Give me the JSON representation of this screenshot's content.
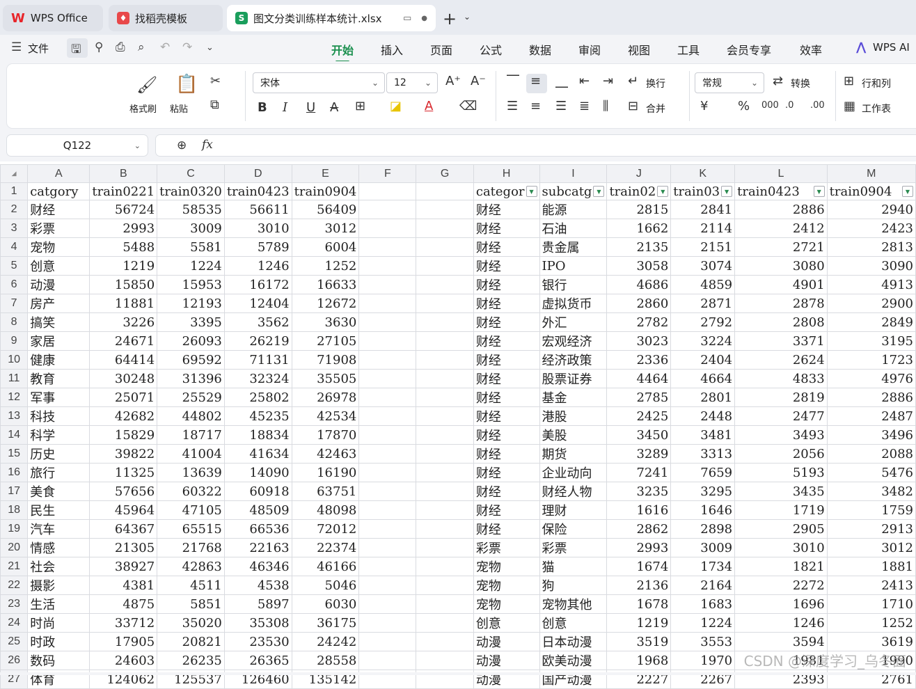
{
  "tabs": [
    {
      "label": "WPS Office",
      "icon": "wps-logo-icon"
    },
    {
      "label": "找稻壳模板",
      "icon": "docer-icon"
    },
    {
      "label": "图文分类训练样本统计.xlsx",
      "icon": "spreadsheet-icon",
      "active": true
    }
  ],
  "menu": {
    "file_label": "文件",
    "tabs": [
      "开始",
      "插入",
      "页面",
      "公式",
      "数据",
      "审阅",
      "视图",
      "工具",
      "会员专享",
      "效率"
    ],
    "active_tab": "开始",
    "ai_label": "WPS AI"
  },
  "ribbon": {
    "format_painter": "格式刷",
    "paste": "粘贴",
    "font_name": "宋体",
    "font_size": "12",
    "wrap": "换行",
    "merge": "合并",
    "number_format": "常规",
    "convert": "转换",
    "row_col": "行和列",
    "worksheet": "工作表"
  },
  "formula_bar": {
    "name_box": "Q122",
    "fx": "fx",
    "content": ""
  },
  "sheet": {
    "columns": [
      "A",
      "B",
      "C",
      "D",
      "E",
      "F",
      "G",
      "H",
      "I",
      "J",
      "K",
      "L",
      "M"
    ],
    "header_row": [
      "catgory",
      "train0221",
      "train0320",
      "train0423",
      "train0904",
      "",
      "",
      "categor",
      "subcatg",
      "train02",
      "train03",
      "train0423",
      "train0904"
    ],
    "rows": [
      [
        "财经",
        "56724",
        "58535",
        "56611",
        "56409",
        "",
        "",
        "财经",
        "能源",
        "2815",
        "2841",
        "2886",
        "2940"
      ],
      [
        "彩票",
        "2993",
        "3009",
        "3010",
        "3012",
        "",
        "",
        "财经",
        "石油",
        "1662",
        "2114",
        "2412",
        "2423"
      ],
      [
        "宠物",
        "5488",
        "5581",
        "5789",
        "6004",
        "",
        "",
        "财经",
        "贵金属",
        "2135",
        "2151",
        "2721",
        "2813"
      ],
      [
        "创意",
        "1219",
        "1224",
        "1246",
        "1252",
        "",
        "",
        "财经",
        "IPO",
        "3058",
        "3074",
        "3080",
        "3090"
      ],
      [
        "动漫",
        "15850",
        "15953",
        "16172",
        "16633",
        "",
        "",
        "财经",
        "银行",
        "4686",
        "4859",
        "4901",
        "4913"
      ],
      [
        "房产",
        "11881",
        "12193",
        "12404",
        "12672",
        "",
        "",
        "财经",
        "虚拟货币",
        "2860",
        "2871",
        "2878",
        "2900"
      ],
      [
        "搞笑",
        "3226",
        "3395",
        "3562",
        "3630",
        "",
        "",
        "财经",
        "外汇",
        "2782",
        "2792",
        "2808",
        "2849"
      ],
      [
        "家居",
        "24671",
        "26093",
        "26219",
        "27105",
        "",
        "",
        "财经",
        "宏观经济",
        "3023",
        "3224",
        "3371",
        "3195"
      ],
      [
        "健康",
        "64414",
        "69592",
        "71131",
        "71908",
        "",
        "",
        "财经",
        "经济政策",
        "2336",
        "2404",
        "2624",
        "1723"
      ],
      [
        "教育",
        "30248",
        "31396",
        "32324",
        "35505",
        "",
        "",
        "财经",
        "股票证券",
        "4464",
        "4664",
        "4833",
        "4976"
      ],
      [
        "军事",
        "25071",
        "25529",
        "25802",
        "26978",
        "",
        "",
        "财经",
        "基金",
        "2785",
        "2801",
        "2819",
        "2886"
      ],
      [
        "科技",
        "42682",
        "44802",
        "45235",
        "42534",
        "",
        "",
        "财经",
        "港股",
        "2425",
        "2448",
        "2477",
        "2487"
      ],
      [
        "科学",
        "15829",
        "18717",
        "18834",
        "17870",
        "",
        "",
        "财经",
        "美股",
        "3450",
        "3481",
        "3493",
        "3496"
      ],
      [
        "历史",
        "39822",
        "41004",
        "41634",
        "42463",
        "",
        "",
        "财经",
        "期货",
        "3289",
        "3313",
        "2056",
        "2088"
      ],
      [
        "旅行",
        "11325",
        "13639",
        "14090",
        "16190",
        "",
        "",
        "财经",
        "企业动向",
        "7241",
        "7659",
        "5193",
        "5476"
      ],
      [
        "美食",
        "57656",
        "60322",
        "60918",
        "63751",
        "",
        "",
        "财经",
        "财经人物",
        "3235",
        "3295",
        "3435",
        "3482"
      ],
      [
        "民生",
        "45964",
        "47105",
        "48509",
        "48098",
        "",
        "",
        "财经",
        "理财",
        "1616",
        "1646",
        "1719",
        "1759"
      ],
      [
        "汽车",
        "64367",
        "65515",
        "66536",
        "72012",
        "",
        "",
        "财经",
        "保险",
        "2862",
        "2898",
        "2905",
        "2913"
      ],
      [
        "情感",
        "21305",
        "21768",
        "22163",
        "22374",
        "",
        "",
        "彩票",
        "彩票",
        "2993",
        "3009",
        "3010",
        "3012"
      ],
      [
        "社会",
        "38927",
        "42863",
        "46346",
        "46166",
        "",
        "",
        "宠物",
        "猫",
        "1674",
        "1734",
        "1821",
        "1881"
      ],
      [
        "摄影",
        "4381",
        "4511",
        "4538",
        "5046",
        "",
        "",
        "宠物",
        "狗",
        "2136",
        "2164",
        "2272",
        "2413"
      ],
      [
        "生活",
        "4875",
        "5851",
        "5897",
        "6030",
        "",
        "",
        "宠物",
        "宠物其他",
        "1678",
        "1683",
        "1696",
        "1710"
      ],
      [
        "时尚",
        "33712",
        "35020",
        "35308",
        "36175",
        "",
        "",
        "创意",
        "创意",
        "1219",
        "1224",
        "1246",
        "1252"
      ],
      [
        "时政",
        "17905",
        "20821",
        "23530",
        "24242",
        "",
        "",
        "动漫",
        "日本动漫",
        "3519",
        "3553",
        "3594",
        "3619"
      ],
      [
        "数码",
        "24603",
        "26235",
        "26365",
        "28558",
        "",
        "",
        "动漫",
        "欧美动漫",
        "1968",
        "1970",
        "1981",
        "1990"
      ],
      [
        "体育",
        "124062",
        "125537",
        "126460",
        "135142",
        "",
        "",
        "动漫",
        "国产动漫",
        "2227",
        "2267",
        "2393",
        "2761"
      ]
    ]
  },
  "watermark": "CSDN @深度学习_乌冬面"
}
